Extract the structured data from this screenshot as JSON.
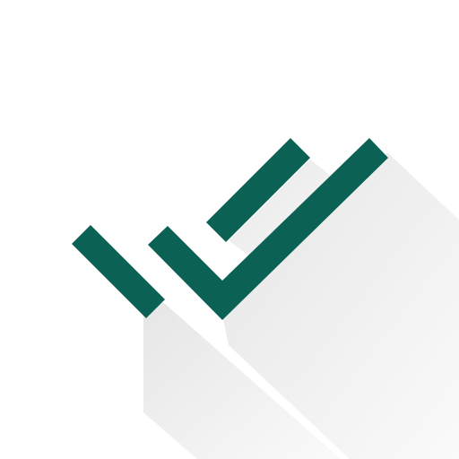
{
  "icon": {
    "name": "double-check-mark-icon",
    "colors": {
      "background": "#ffffff",
      "mark": "#0c6155",
      "long_shadow": "#000000"
    }
  }
}
